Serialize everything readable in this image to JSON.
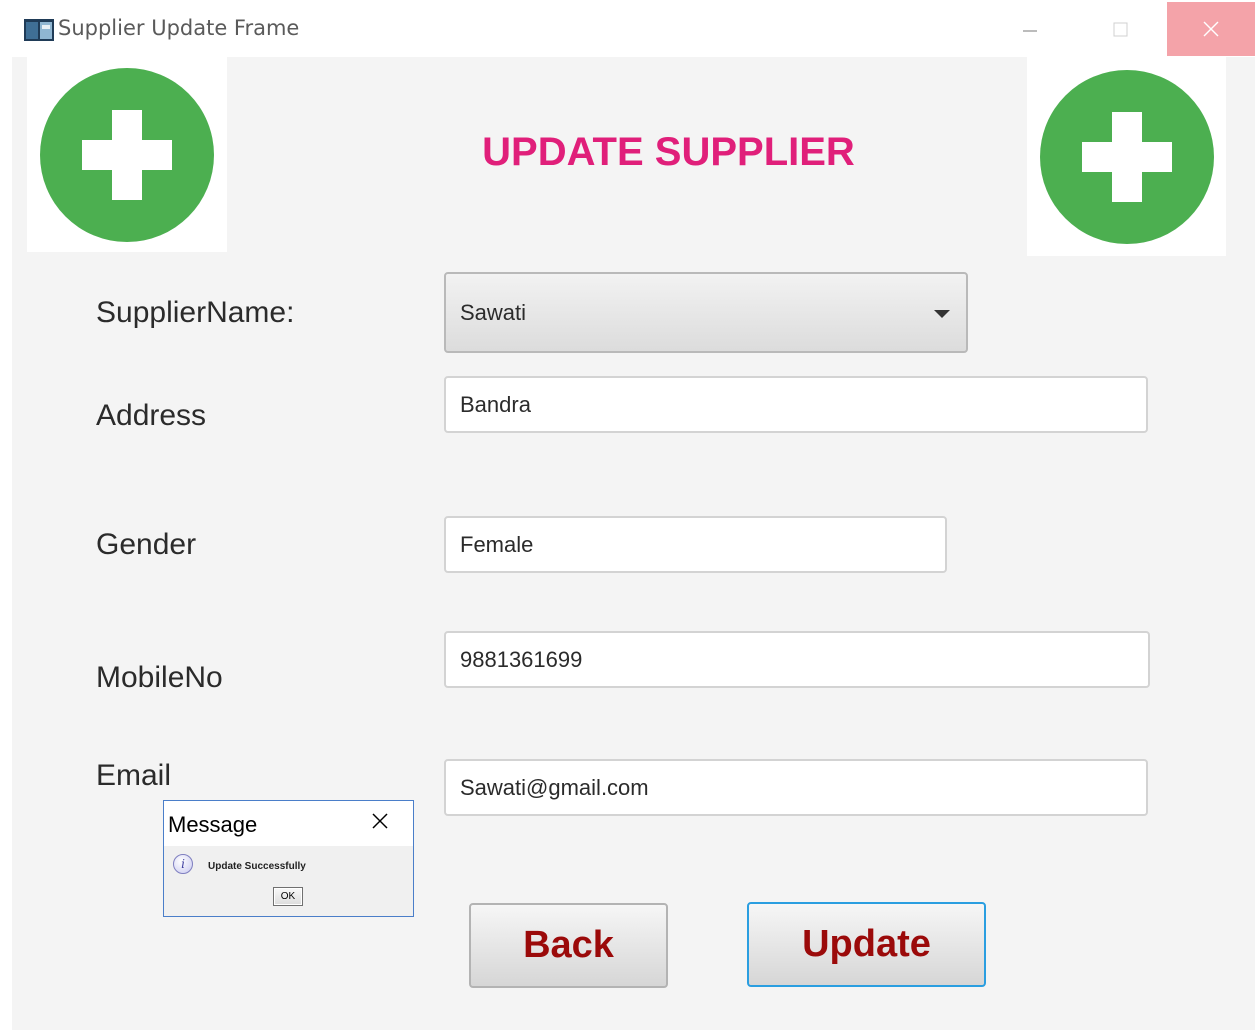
{
  "window": {
    "title": "Supplier Update Frame",
    "app_icon": "window-app-icon",
    "controls": [
      "minimize-icon",
      "maximize-icon",
      "close-icon"
    ]
  },
  "header": {
    "heading": "UPDATE SUPPLIER",
    "logo_icon": "plus-circle-icon",
    "logo_color": "#4caf50"
  },
  "form": {
    "supplier_name": {
      "label": "SupplierName:",
      "value": "Sawati"
    },
    "address": {
      "label": "Address",
      "value": "Bandra"
    },
    "gender": {
      "label": "Gender",
      "value": "Female"
    },
    "mobile": {
      "label": "MobileNo",
      "value": "9881361699"
    },
    "email": {
      "label": "Email",
      "value": "Sawati@gmail.com"
    }
  },
  "buttons": {
    "back": "Back",
    "update": "Update"
  },
  "dialog": {
    "title": "Message",
    "icon": "info-icon",
    "message": "Update Successfully",
    "ok": "OK"
  },
  "colors": {
    "heading": "#e01f7a",
    "button_text": "#9b0a0a",
    "close_hover": "#f4a3a9",
    "focus_border": "#2a9ee0"
  }
}
